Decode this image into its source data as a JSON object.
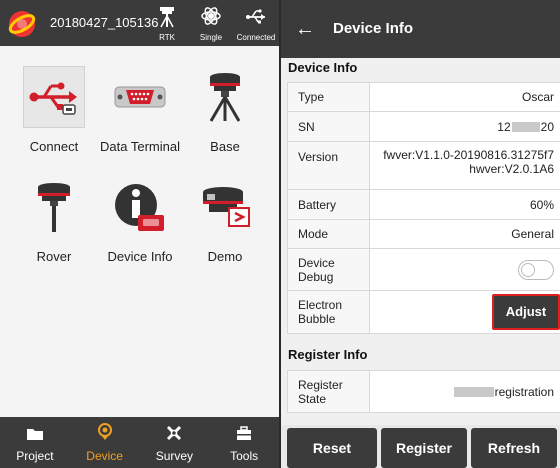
{
  "left": {
    "job_name": "20180427_105136",
    "status": [
      {
        "label": "RTK",
        "icon": "rover-pole-icon"
      },
      {
        "label": "Single",
        "icon": "satellite-icon"
      },
      {
        "label": "Connected",
        "icon": "usb-icon"
      }
    ],
    "tiles": [
      {
        "label": "Connect",
        "icon": "usb-connect-icon"
      },
      {
        "label": "Data Terminal",
        "icon": "serial-port-icon"
      },
      {
        "label": "Base",
        "icon": "base-receiver-icon"
      },
      {
        "label": "Rover",
        "icon": "rover-receiver-icon"
      },
      {
        "label": "Device Info",
        "icon": "info-icon"
      },
      {
        "label": "Demo",
        "icon": "demo-icon"
      }
    ],
    "nav": [
      {
        "label": "Project",
        "icon": "folder-icon"
      },
      {
        "label": "Device",
        "icon": "device-pin-icon"
      },
      {
        "label": "Survey",
        "icon": "survey-icon"
      },
      {
        "label": "Tools",
        "icon": "toolbox-icon"
      }
    ],
    "active_nav": "Device",
    "active_color": "#f0a020"
  },
  "right": {
    "title": "Device Info",
    "device_info_title": "Device Info",
    "rows": {
      "type": {
        "key": "Type",
        "value": "Oscar"
      },
      "sn": {
        "key": "SN",
        "value_prefix": "12",
        "value_suffix": "20"
      },
      "version": {
        "key": "Version",
        "value_line1": "fwver:V1.1.0-20190816.31275f7",
        "value_line2": "hwver:V2.0.1A6"
      },
      "battery": {
        "key": "Battery",
        "value": "60%"
      },
      "mode": {
        "key": "Mode",
        "value": "General"
      },
      "debug": {
        "key": "Device Debug",
        "toggle_on": false
      },
      "bubble": {
        "key": "Electron Bubble",
        "button": "Adjust"
      }
    },
    "register_info_title": "Register Info",
    "register_state": {
      "key": "Register State",
      "value": "registration"
    },
    "buttons": {
      "reset": "Reset",
      "register": "Register",
      "refresh": "Refresh"
    },
    "highlight_color": "#e02020"
  }
}
